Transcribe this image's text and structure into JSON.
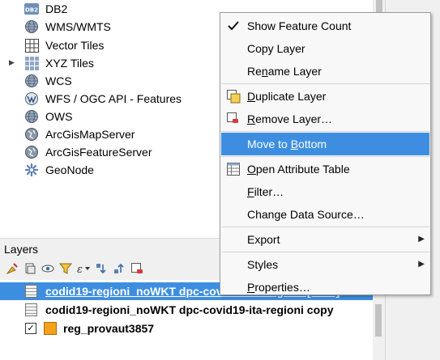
{
  "browser": {
    "items": [
      {
        "label": "DB2",
        "icon": "db2-icon",
        "expandable": false
      },
      {
        "label": "WMS/WMTS",
        "icon": "globe-icon",
        "expandable": false
      },
      {
        "label": "Vector Tiles",
        "icon": "grid-icon",
        "expandable": false
      },
      {
        "label": "XYZ Tiles",
        "icon": "xyz-grid-icon",
        "expandable": true
      },
      {
        "label": "WCS",
        "icon": "globe-icon",
        "expandable": false
      },
      {
        "label": "WFS / OGC API - Features",
        "icon": "wfs-icon",
        "expandable": false
      },
      {
        "label": "OWS",
        "icon": "globe-icon",
        "expandable": false
      },
      {
        "label": "ArcGisMapServer",
        "icon": "arcgis-globe-icon",
        "expandable": false
      },
      {
        "label": "ArcGisFeatureServer",
        "icon": "arcgis-globe-icon",
        "expandable": false
      },
      {
        "label": "GeoNode",
        "icon": "geonode-icon",
        "expandable": false
      }
    ],
    "db2_badge": "DB2"
  },
  "layers": {
    "title": "Layers",
    "toolbar_icons": [
      "open-layer-styling-icon",
      "add-group-icon",
      "manage-visibility-icon",
      "filter-legend-icon",
      "filter-expression-icon",
      "expand-all-icon",
      "collapse-all-icon",
      "remove-layer-icon"
    ],
    "rows": [
      {
        "name": "codid19-regioni_noWKT dpc-covid19-ita-regioni [4979]",
        "selected": true,
        "checked": true,
        "type": "table"
      },
      {
        "name": "codid19-regioni_noWKT dpc-covid19-ita-regioni copy",
        "selected": false,
        "checked": true,
        "type": "table"
      },
      {
        "name": "reg_provaut3857",
        "selected": false,
        "checked": true,
        "type": "polygon",
        "color": "#f3a21d"
      }
    ]
  },
  "context_menu": {
    "items": [
      {
        "label": "Show Feature Count",
        "checked": true,
        "icon": "checkmark-icon"
      },
      {
        "label": "Copy Layer"
      },
      {
        "label": "Rename Layer",
        "mnemonic": "n"
      },
      {
        "separator": true
      },
      {
        "label": "Duplicate Layer",
        "mnemonic": "D",
        "icon": "duplicate-layer-icon"
      },
      {
        "label": "Remove Layer…",
        "mnemonic": "R",
        "icon": "remove-layer-icon"
      },
      {
        "separator": true
      },
      {
        "label": "Move to Bottom",
        "mnemonic": "B",
        "highlighted": true
      },
      {
        "separator": true
      },
      {
        "label": "Open Attribute Table",
        "mnemonic": "O",
        "icon": "attribute-table-icon"
      },
      {
        "label": "Filter…",
        "mnemonic": "F"
      },
      {
        "label": "Change Data Source…"
      },
      {
        "separator": true
      },
      {
        "label": "Export",
        "submenu": true
      },
      {
        "separator": true
      },
      {
        "label": "Styles",
        "submenu": true
      },
      {
        "label": "Properties…",
        "mnemonic": "P"
      }
    ]
  },
  "colors": {
    "highlight": "#3d8ee0",
    "menu_bg": "#f8f8f8",
    "panel_bg": "#f0f0f0"
  }
}
